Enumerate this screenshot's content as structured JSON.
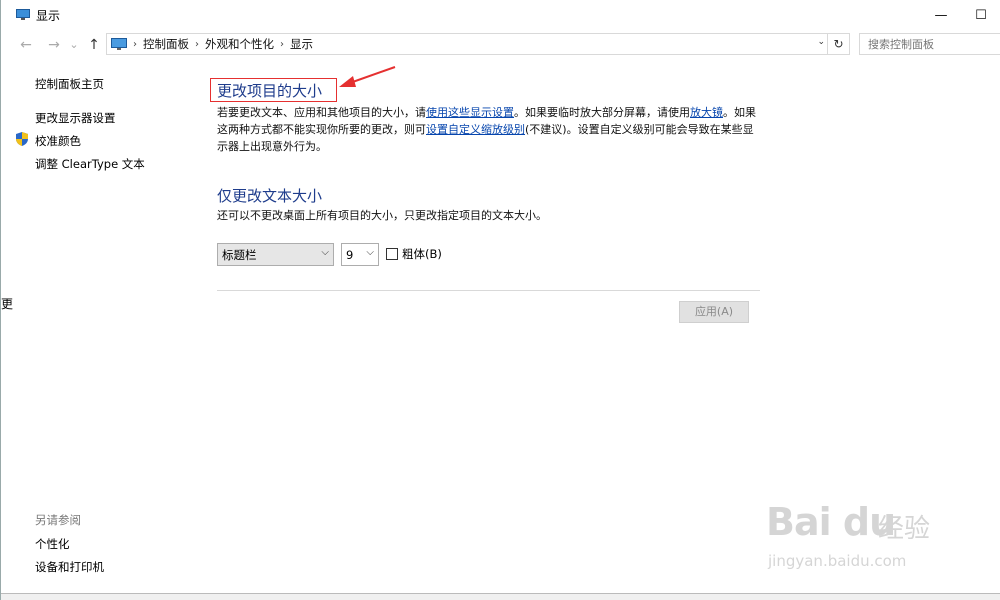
{
  "window": {
    "title": "显示",
    "controls": {
      "minimize": "—",
      "maximize": "☐"
    }
  },
  "nav": {
    "back": "←",
    "forward": "→",
    "recent": "⌄",
    "up": "↑"
  },
  "address": {
    "crumbs": [
      "控制面板",
      "外观和个性化",
      "显示"
    ],
    "separator": "›",
    "dropdown": "⌄",
    "refresh": "↻"
  },
  "search": {
    "placeholder": "搜索控制面板"
  },
  "sidebar": {
    "home": "控制面板主页",
    "links": [
      "更改显示器设置",
      "校准颜色",
      "调整 ClearType 文本"
    ],
    "see_also_title": "另请参阅",
    "see_also": [
      "个性化",
      "设备和打印机"
    ]
  },
  "main": {
    "heading1": "更改项目的大小",
    "para1": {
      "t1": "若要更改文本、应用和其他项目的大小，请",
      "link1": "使用这些显示设置",
      "t2": "。如果要临时放大部分屏幕，请使用",
      "link2": "放大镜",
      "t3": "。如果这两种方式都不能实现你所要的更改，则可",
      "link3": "设置自定义缩放级别",
      "t4": "(不建议)。设置自定义级别可能会导致在某些显示器上出现意外行为。"
    },
    "heading2": "仅更改文本大小",
    "para2": "还可以不更改桌面上所有项目的大小，只更改指定项目的文本大小。",
    "item_select": "标题栏",
    "size_select": "9",
    "bold_label": "粗体(B)",
    "apply": "应用(A)"
  },
  "edge_char": "更",
  "watermark": {
    "logo": "Bai du",
    "cn": "经验",
    "url": "jingyan.baidu.com"
  },
  "colors": {
    "heading": "#1e3c8c",
    "link": "#0645ad",
    "highlight_box": "#e53030"
  }
}
